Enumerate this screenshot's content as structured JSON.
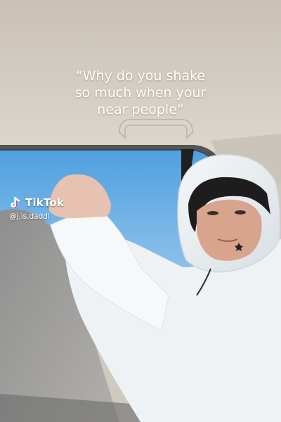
{
  "caption": {
    "text": "“Why do you shake\nso much when your\nnear people”"
  },
  "watermark": {
    "brand": "TikTok",
    "handle": "@j.is.daddi",
    "logo_icon": "tiktok-note-icon"
  },
  "scene": {
    "description_icon": "car-interior-photo",
    "colors": {
      "ceiling": "#d3cbc0",
      "sky": "#6fb0e2",
      "hoodie": "#e9eef1",
      "hair": "#1e1c1c",
      "pants": "#9a9a9a"
    }
  }
}
